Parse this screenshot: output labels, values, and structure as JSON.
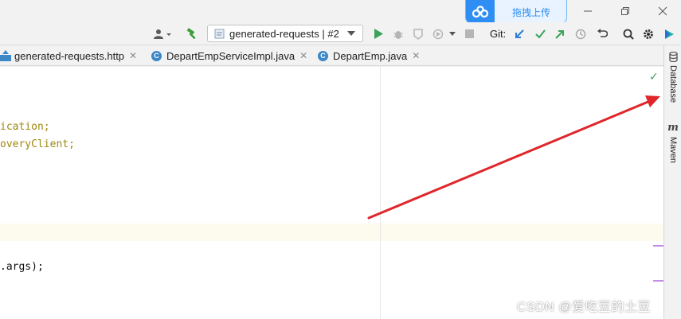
{
  "titlebar": {
    "upload_label": "拖拽上传",
    "colors": {
      "upload_accent": "#2f8ef3"
    }
  },
  "toolbar": {
    "run_config": "generated-requests | #2",
    "git_label": "Git:"
  },
  "tabs": [
    {
      "label": "generated-requests.http",
      "icon": "api-http-icon"
    },
    {
      "label": "DepartEmpServiceImpl.java",
      "icon": "class-icon",
      "badge": "C"
    },
    {
      "label": "DepartEmp.java",
      "icon": "class-icon",
      "badge": "C"
    }
  ],
  "editor": {
    "lines": [
      {
        "plain": "ication;"
      },
      {
        "plain": "overyClient;"
      },
      {
        "plain": ".args);"
      }
    ]
  },
  "right_strip": {
    "database_label": "Database",
    "maven_label": "Maven"
  },
  "watermark": "CSDN @爱吃豆的土豆",
  "annotation": {
    "color": "#e0262b"
  }
}
